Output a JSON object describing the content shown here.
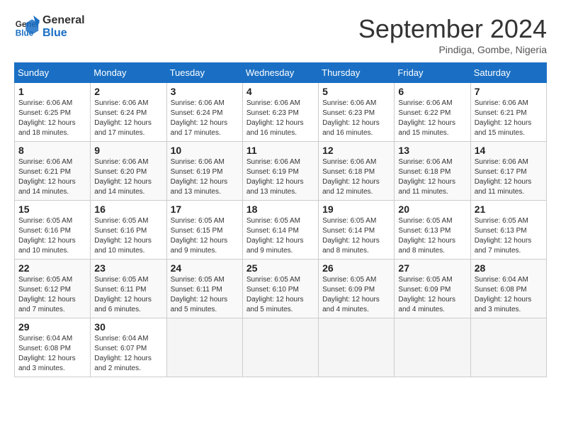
{
  "logo": {
    "line1": "General",
    "line2": "Blue"
  },
  "title": "September 2024",
  "subtitle": "Pindiga, Gombe, Nigeria",
  "headers": [
    "Sunday",
    "Monday",
    "Tuesday",
    "Wednesday",
    "Thursday",
    "Friday",
    "Saturday"
  ],
  "weeks": [
    [
      {
        "day": "1",
        "info": "Sunrise: 6:06 AM\nSunset: 6:25 PM\nDaylight: 12 hours\nand 18 minutes."
      },
      {
        "day": "2",
        "info": "Sunrise: 6:06 AM\nSunset: 6:24 PM\nDaylight: 12 hours\nand 17 minutes."
      },
      {
        "day": "3",
        "info": "Sunrise: 6:06 AM\nSunset: 6:24 PM\nDaylight: 12 hours\nand 17 minutes."
      },
      {
        "day": "4",
        "info": "Sunrise: 6:06 AM\nSunset: 6:23 PM\nDaylight: 12 hours\nand 16 minutes."
      },
      {
        "day": "5",
        "info": "Sunrise: 6:06 AM\nSunset: 6:23 PM\nDaylight: 12 hours\nand 16 minutes."
      },
      {
        "day": "6",
        "info": "Sunrise: 6:06 AM\nSunset: 6:22 PM\nDaylight: 12 hours\nand 15 minutes."
      },
      {
        "day": "7",
        "info": "Sunrise: 6:06 AM\nSunset: 6:21 PM\nDaylight: 12 hours\nand 15 minutes."
      }
    ],
    [
      {
        "day": "8",
        "info": "Sunrise: 6:06 AM\nSunset: 6:21 PM\nDaylight: 12 hours\nand 14 minutes."
      },
      {
        "day": "9",
        "info": "Sunrise: 6:06 AM\nSunset: 6:20 PM\nDaylight: 12 hours\nand 14 minutes."
      },
      {
        "day": "10",
        "info": "Sunrise: 6:06 AM\nSunset: 6:19 PM\nDaylight: 12 hours\nand 13 minutes."
      },
      {
        "day": "11",
        "info": "Sunrise: 6:06 AM\nSunset: 6:19 PM\nDaylight: 12 hours\nand 13 minutes."
      },
      {
        "day": "12",
        "info": "Sunrise: 6:06 AM\nSunset: 6:18 PM\nDaylight: 12 hours\nand 12 minutes."
      },
      {
        "day": "13",
        "info": "Sunrise: 6:06 AM\nSunset: 6:18 PM\nDaylight: 12 hours\nand 11 minutes."
      },
      {
        "day": "14",
        "info": "Sunrise: 6:06 AM\nSunset: 6:17 PM\nDaylight: 12 hours\nand 11 minutes."
      }
    ],
    [
      {
        "day": "15",
        "info": "Sunrise: 6:05 AM\nSunset: 6:16 PM\nDaylight: 12 hours\nand 10 minutes."
      },
      {
        "day": "16",
        "info": "Sunrise: 6:05 AM\nSunset: 6:16 PM\nDaylight: 12 hours\nand 10 minutes."
      },
      {
        "day": "17",
        "info": "Sunrise: 6:05 AM\nSunset: 6:15 PM\nDaylight: 12 hours\nand 9 minutes."
      },
      {
        "day": "18",
        "info": "Sunrise: 6:05 AM\nSunset: 6:14 PM\nDaylight: 12 hours\nand 9 minutes."
      },
      {
        "day": "19",
        "info": "Sunrise: 6:05 AM\nSunset: 6:14 PM\nDaylight: 12 hours\nand 8 minutes."
      },
      {
        "day": "20",
        "info": "Sunrise: 6:05 AM\nSunset: 6:13 PM\nDaylight: 12 hours\nand 8 minutes."
      },
      {
        "day": "21",
        "info": "Sunrise: 6:05 AM\nSunset: 6:13 PM\nDaylight: 12 hours\nand 7 minutes."
      }
    ],
    [
      {
        "day": "22",
        "info": "Sunrise: 6:05 AM\nSunset: 6:12 PM\nDaylight: 12 hours\nand 7 minutes."
      },
      {
        "day": "23",
        "info": "Sunrise: 6:05 AM\nSunset: 6:11 PM\nDaylight: 12 hours\nand 6 minutes."
      },
      {
        "day": "24",
        "info": "Sunrise: 6:05 AM\nSunset: 6:11 PM\nDaylight: 12 hours\nand 5 minutes."
      },
      {
        "day": "25",
        "info": "Sunrise: 6:05 AM\nSunset: 6:10 PM\nDaylight: 12 hours\nand 5 minutes."
      },
      {
        "day": "26",
        "info": "Sunrise: 6:05 AM\nSunset: 6:09 PM\nDaylight: 12 hours\nand 4 minutes."
      },
      {
        "day": "27",
        "info": "Sunrise: 6:05 AM\nSunset: 6:09 PM\nDaylight: 12 hours\nand 4 minutes."
      },
      {
        "day": "28",
        "info": "Sunrise: 6:04 AM\nSunset: 6:08 PM\nDaylight: 12 hours\nand 3 minutes."
      }
    ],
    [
      {
        "day": "29",
        "info": "Sunrise: 6:04 AM\nSunset: 6:08 PM\nDaylight: 12 hours\nand 3 minutes."
      },
      {
        "day": "30",
        "info": "Sunrise: 6:04 AM\nSunset: 6:07 PM\nDaylight: 12 hours\nand 2 minutes."
      },
      {
        "day": "",
        "info": ""
      },
      {
        "day": "",
        "info": ""
      },
      {
        "day": "",
        "info": ""
      },
      {
        "day": "",
        "info": ""
      },
      {
        "day": "",
        "info": ""
      }
    ]
  ]
}
